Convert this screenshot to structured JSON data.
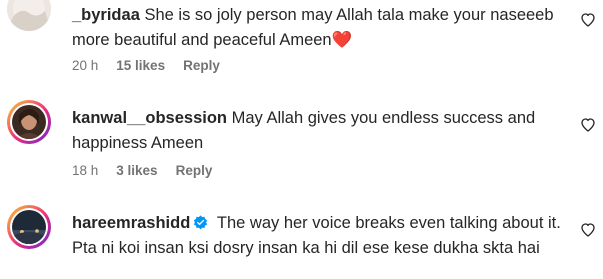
{
  "comments": [
    {
      "username": "_byridaa",
      "text": "She is so joly person may Allah tala make your naseeeb more beautiful and peaceful Ameen",
      "emoji": "❤️",
      "time": "20 h",
      "likes": "15 likes",
      "reply": "Reply",
      "verified": false
    },
    {
      "username": "kanwal__obsession",
      "text": "May Allah gives you endless success and happiness Ameen",
      "time": "18 h",
      "likes": "3 likes",
      "reply": "Reply",
      "verified": false
    },
    {
      "username": "hareemrashidd",
      "text": "The way her voice breaks even talking about it. Pta ni koi insan ksi dosry insan ka hi dil ese kese dukha skta hai",
      "verified": true
    }
  ],
  "colors": {
    "text": "#262626",
    "meta": "#737373",
    "verified": "#0095f6",
    "heart_emoji": "#e0245e"
  },
  "icons": {
    "like": "heart-outline-icon",
    "verified": "verified-badge-icon"
  }
}
